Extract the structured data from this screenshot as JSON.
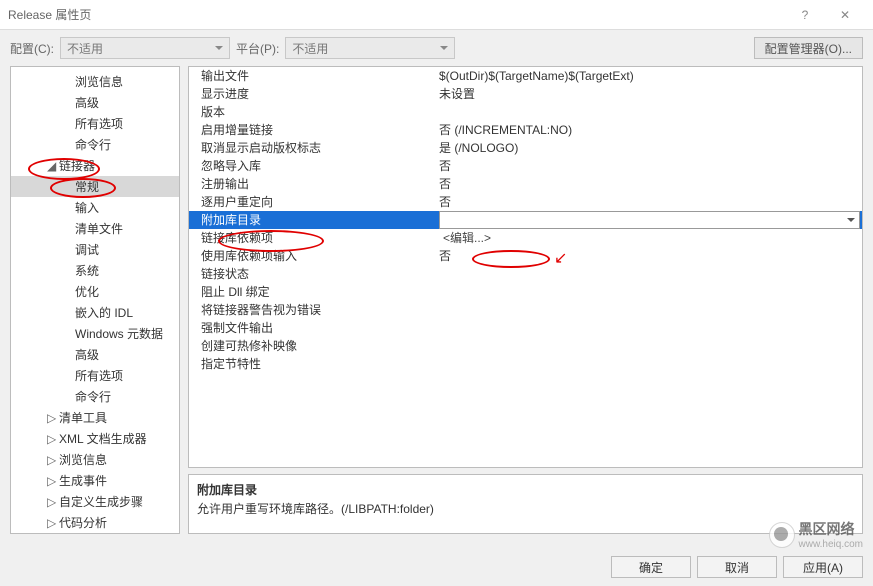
{
  "title": "Release 属性页",
  "toolbar": {
    "config_label": "配置(C):",
    "config_value": "不适用",
    "platform_label": "平台(P):",
    "platform_value": "不适用",
    "manager_button": "配置管理器(O)..."
  },
  "tree": [
    {
      "label": "浏览信息",
      "indent": 2,
      "arrow": ""
    },
    {
      "label": "高级",
      "indent": 2,
      "arrow": ""
    },
    {
      "label": "所有选项",
      "indent": 2,
      "arrow": ""
    },
    {
      "label": "命令行",
      "indent": 2,
      "arrow": ""
    },
    {
      "label": "链接器",
      "indent": 1,
      "arrow": "◢"
    },
    {
      "label": "常规",
      "indent": 2,
      "arrow": "",
      "selected": true
    },
    {
      "label": "输入",
      "indent": 2,
      "arrow": ""
    },
    {
      "label": "清单文件",
      "indent": 2,
      "arrow": ""
    },
    {
      "label": "调试",
      "indent": 2,
      "arrow": ""
    },
    {
      "label": "系统",
      "indent": 2,
      "arrow": ""
    },
    {
      "label": "优化",
      "indent": 2,
      "arrow": ""
    },
    {
      "label": "嵌入的 IDL",
      "indent": 2,
      "arrow": ""
    },
    {
      "label": "Windows 元数据",
      "indent": 2,
      "arrow": ""
    },
    {
      "label": "高级",
      "indent": 2,
      "arrow": ""
    },
    {
      "label": "所有选项",
      "indent": 2,
      "arrow": ""
    },
    {
      "label": "命令行",
      "indent": 2,
      "arrow": ""
    },
    {
      "label": "清单工具",
      "indent": 1,
      "arrow": "▷"
    },
    {
      "label": "XML 文档生成器",
      "indent": 1,
      "arrow": "▷"
    },
    {
      "label": "浏览信息",
      "indent": 1,
      "arrow": "▷"
    },
    {
      "label": "生成事件",
      "indent": 1,
      "arrow": "▷"
    },
    {
      "label": "自定义生成步骤",
      "indent": 1,
      "arrow": "▷"
    },
    {
      "label": "代码分析",
      "indent": 1,
      "arrow": "▷"
    }
  ],
  "grid": [
    {
      "label": "输出文件",
      "value": "$(OutDir)$(TargetName)$(TargetExt)"
    },
    {
      "label": "显示进度",
      "value": "未设置"
    },
    {
      "label": "版本",
      "value": ""
    },
    {
      "label": "启用增量链接",
      "value": "否 (/INCREMENTAL:NO)"
    },
    {
      "label": "取消显示启动版权标志",
      "value": "是 (/NOLOGO)"
    },
    {
      "label": "忽略导入库",
      "value": "否"
    },
    {
      "label": "注册输出",
      "value": "否"
    },
    {
      "label": "逐用户重定向",
      "value": "否"
    },
    {
      "label": "附加库目录",
      "value": "",
      "selected": true,
      "dropdown": true
    },
    {
      "label": "链接库依赖项",
      "value": "<编辑...>",
      "edit": true
    },
    {
      "label": "使用库依赖项输入",
      "value": "否"
    },
    {
      "label": "链接状态",
      "value": ""
    },
    {
      "label": "阻止 Dll 绑定",
      "value": ""
    },
    {
      "label": "将链接器警告视为错误",
      "value": ""
    },
    {
      "label": "强制文件输出",
      "value": ""
    },
    {
      "label": "创建可热修补映像",
      "value": ""
    },
    {
      "label": "指定节特性",
      "value": ""
    }
  ],
  "desc": {
    "heading": "附加库目录",
    "text": "允许用户重写环境库路径。(/LIBPATH:folder)"
  },
  "footer": {
    "ok": "确定",
    "cancel": "取消",
    "apply": "应用(A)"
  },
  "watermark": {
    "line1": "黑区网络",
    "line2": "www.heiq.com"
  }
}
